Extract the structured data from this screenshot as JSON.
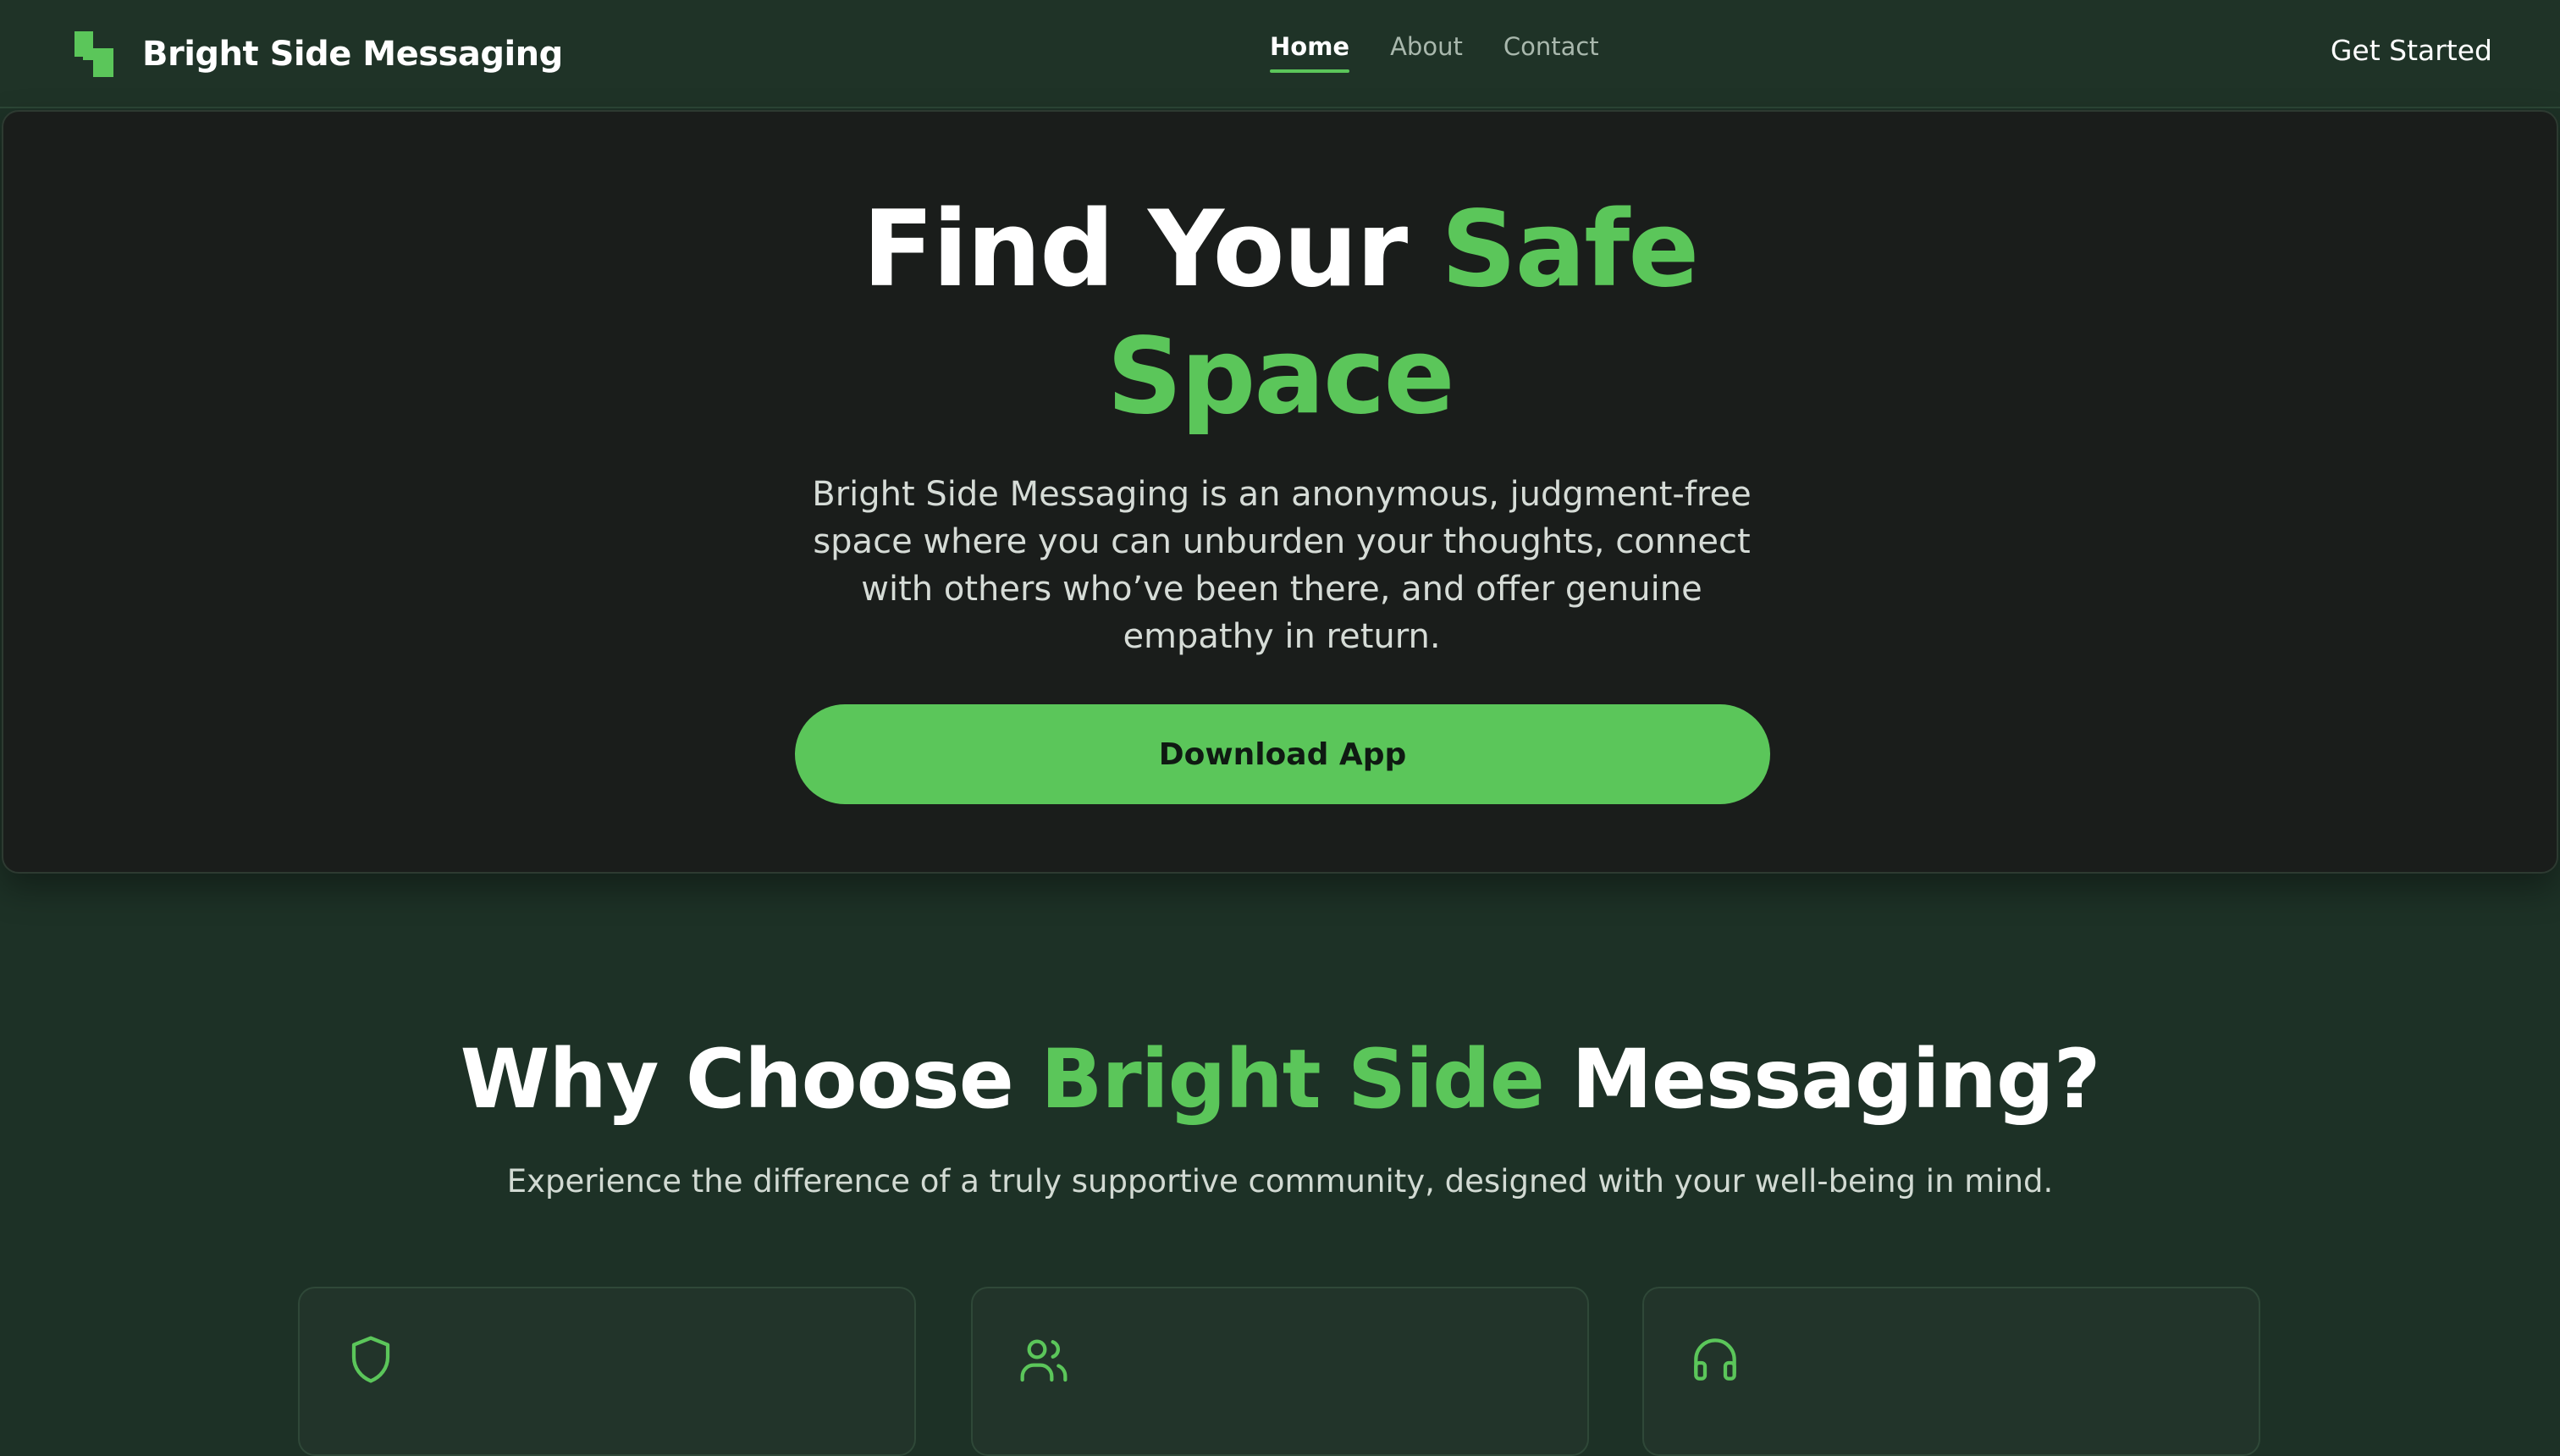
{
  "brand": {
    "name": "Bright Side Messaging",
    "logo_icon": "blocks-logo-icon"
  },
  "nav": {
    "links": [
      {
        "label": "Home",
        "active": true
      },
      {
        "label": "About",
        "active": false
      },
      {
        "label": "Contact",
        "active": false
      }
    ],
    "cta_label": "Get Started"
  },
  "hero": {
    "title_line1_plain": "Find Your ",
    "title_line1_accent": "Safe",
    "title_line2_accent": "Space",
    "description": "Bright Side Messaging is an anonymous, judgment-free space where you can unburden your thoughts, connect with others who’ve been there, and offer genuine empathy in return.",
    "button_label": "Download App"
  },
  "why": {
    "title_plain_start": "Why Choose ",
    "title_accent": "Bright Side",
    "title_plain_end": " Messaging?",
    "subtitle": "Experience the difference of a truly supportive community, designed with your well-being in mind.",
    "cards": [
      {
        "icon": "shield-icon"
      },
      {
        "icon": "users-icon"
      },
      {
        "icon": "headphones-icon"
      }
    ]
  },
  "colors": {
    "accent": "#5bc65a",
    "page_background": "#1d3126",
    "hero_background": "#1a1d1b",
    "card_background": "#22342a"
  }
}
